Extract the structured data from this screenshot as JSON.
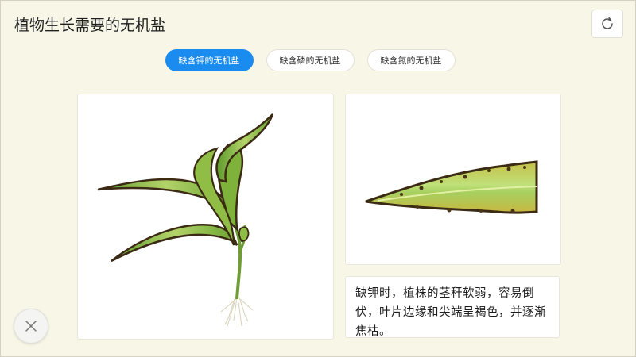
{
  "header": {
    "title": "植物生长需要的无机盐"
  },
  "toolbar": {
    "refresh_icon": "refresh-icon",
    "close_icon": "close-icon"
  },
  "tabs": [
    {
      "label": "缺含钾的无机盐",
      "active": true
    },
    {
      "label": "缺含磷的无机盐",
      "active": false
    },
    {
      "label": "缺含氮的无机盐",
      "active": false
    }
  ],
  "content": {
    "description": "缺钾时，植株的茎秆软弱，容易倒伏，叶片边缘和尖端呈褐色，并逐渐焦枯。"
  },
  "colors": {
    "accent": "#1a8cf0",
    "background": "#f8f6e7",
    "leaf_green": "#7fb23a",
    "leaf_edge": "#3b2a14"
  }
}
